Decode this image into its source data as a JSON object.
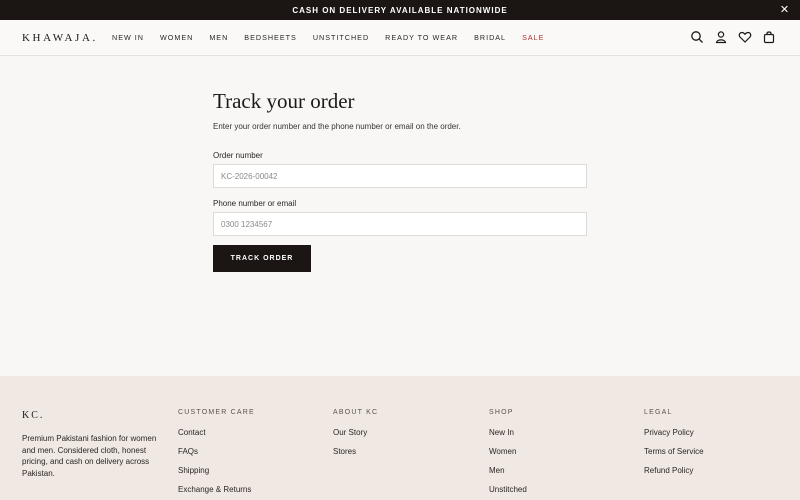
{
  "announcement": {
    "text": "CASH ON DELIVERY AVAILABLE NATIONWIDE",
    "close_icon": "close-icon"
  },
  "header": {
    "logo": "KHAWAJA.",
    "nav": [
      {
        "label": "NEW IN"
      },
      {
        "label": "WOMEN"
      },
      {
        "label": "MEN"
      },
      {
        "label": "BEDSHEETS"
      },
      {
        "label": "UNSTITCHED"
      },
      {
        "label": "READY TO WEAR"
      },
      {
        "label": "BRIDAL"
      },
      {
        "label": "SALE"
      }
    ],
    "icons": [
      "search-icon",
      "account-icon",
      "wishlist-icon",
      "cart-icon"
    ]
  },
  "track": {
    "title": "Track your order",
    "subtitle": "Enter your order number and the phone number or email on the order.",
    "order_label": "Order number",
    "order_placeholder": "KC-2026-00042",
    "contact_label": "Phone number or email",
    "contact_placeholder": "0300 1234567",
    "button": "TRACK ORDER"
  },
  "footer": {
    "logo": "KC.",
    "about": "Premium Pakistani fashion for women and men. Considered cloth, honest pricing, and cash on delivery across Pakistan.",
    "columns": [
      {
        "heading": "CUSTOMER CARE",
        "links": [
          "Contact",
          "FAQs",
          "Shipping",
          "Exchange & Returns"
        ]
      },
      {
        "heading": "ABOUT KC",
        "links": [
          "Our Story",
          "Stores"
        ]
      },
      {
        "heading": "SHOP",
        "links": [
          "New In",
          "Women",
          "Men",
          "Unstitched"
        ]
      },
      {
        "heading": "LEGAL",
        "links": [
          "Privacy Policy",
          "Terms of Service",
          "Refund Policy"
        ]
      }
    ]
  },
  "colors": {
    "dark": "#1b1614",
    "sale": "#b3302a",
    "footer_bg": "#f0e9e3",
    "page_bg": "#f9f7f5"
  }
}
